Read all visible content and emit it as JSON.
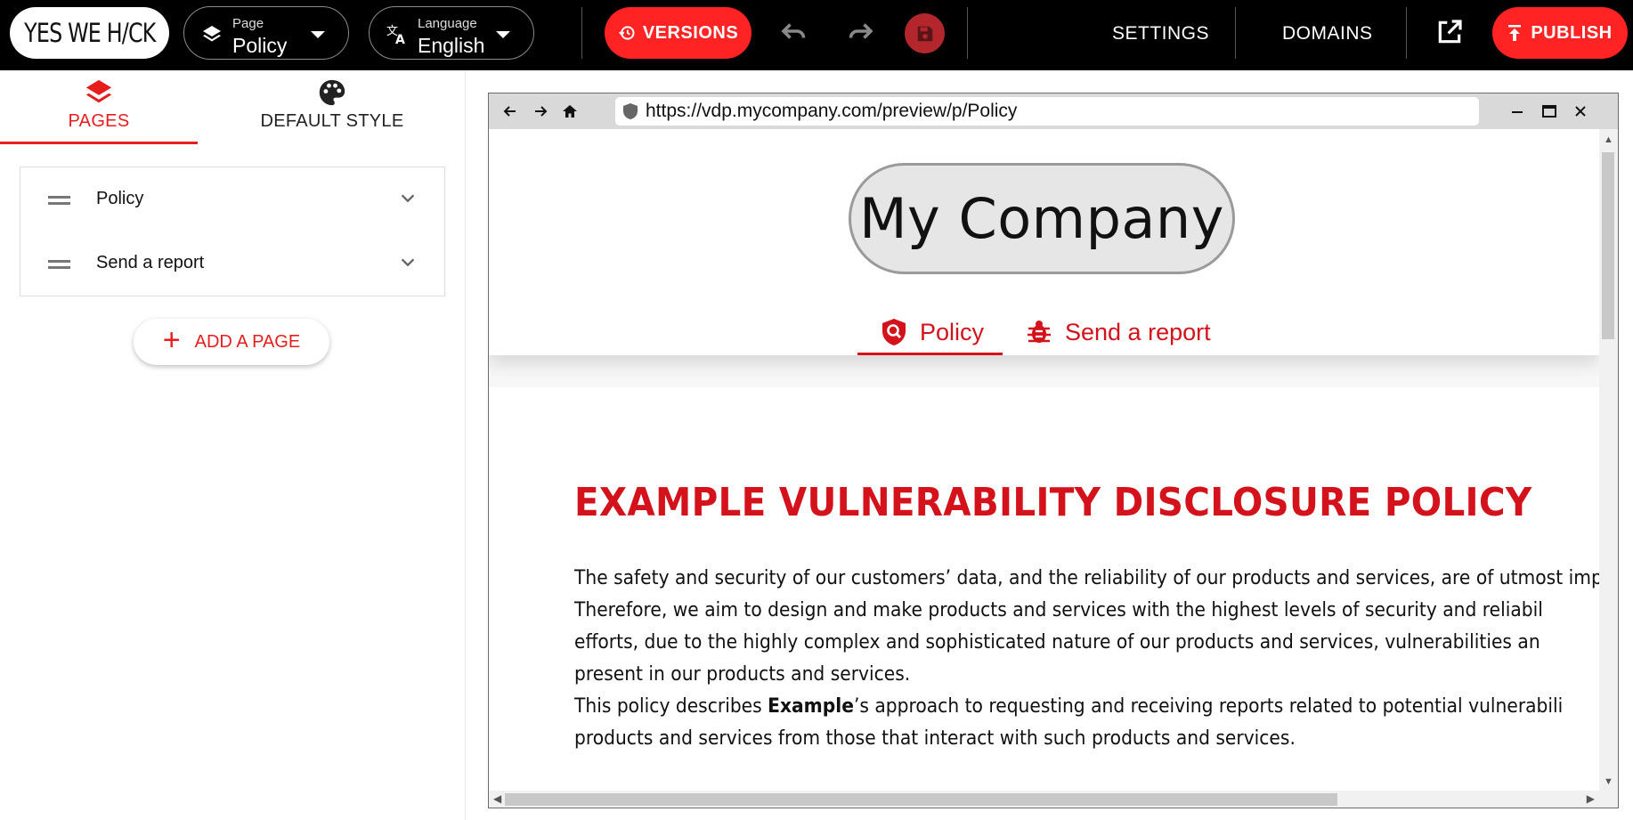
{
  "topbar": {
    "logo_text": "YES WE H/CK",
    "page_selector": {
      "small_label": "Page",
      "value": "Policy"
    },
    "language_selector": {
      "small_label": "Language",
      "value": "English"
    },
    "versions_label": "VERSIONS",
    "settings_label": "SETTINGS",
    "domains_label": "DOMAINS",
    "publish_label": "PUBLISH"
  },
  "left_panel": {
    "tabs": [
      {
        "label": "PAGES",
        "icon": "layers-icon",
        "active": true
      },
      {
        "label": "DEFAULT STYLE",
        "icon": "palette-icon",
        "active": false
      }
    ],
    "pages": [
      {
        "name": "Policy"
      },
      {
        "name": "Send a report"
      }
    ],
    "add_page_label": "ADD A PAGE"
  },
  "preview": {
    "url": "https://vdp.mycompany.com/preview/p/Policy",
    "site": {
      "company_name": "My Company",
      "nav": [
        {
          "label": "Policy",
          "icon": "shield-search-icon",
          "active": true
        },
        {
          "label": "Send a report",
          "icon": "bug-icon",
          "active": false
        }
      ],
      "title_bold": "EXAMPLE",
      "title_rest": "VULNERABILITY DISCLOSURE POLICY",
      "paragraph1": [
        "The safety and security of our customers’ data, and the reliability of our products and services, are of utmost imp",
        "Therefore, we aim to design and make products and services with the highest levels of security and reliabil",
        "efforts, due to the highly complex and sophisticated nature of our products and services, vulnerabilities an",
        "present in our products and services."
      ],
      "paragraph2_line1_pre": "This policy describes ",
      "paragraph2_line1_bold": "Example",
      "paragraph2_line1_post": "’s approach to requesting and receiving reports related to potential vulnerabili",
      "paragraph2_line2": "products and services from those that interact with such products and services."
    }
  },
  "colors": {
    "accent": "#ff2323",
    "site_red": "#d4121b",
    "topbar_bg": "#000000"
  }
}
